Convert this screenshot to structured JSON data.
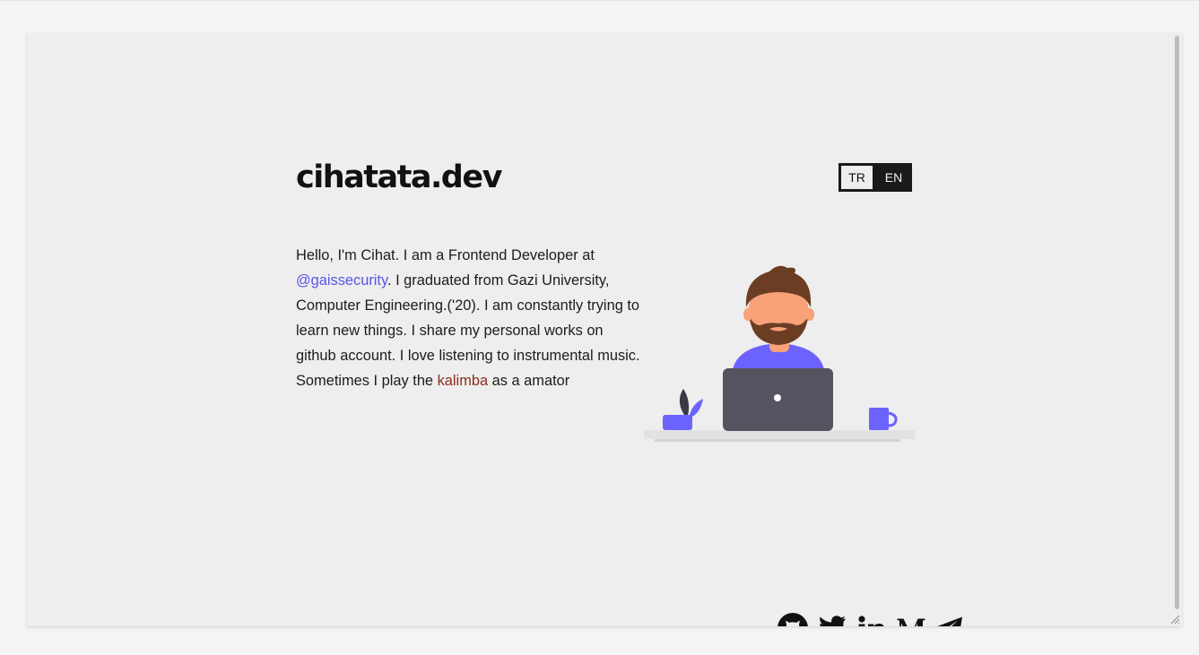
{
  "site": {
    "title": "cihatata.dev"
  },
  "language": {
    "options": [
      {
        "label": "TR",
        "active": true
      },
      {
        "label": "EN",
        "active": false
      }
    ]
  },
  "bio": {
    "part1": "Hello, I'm Cihat. I am a Frontend Developer at ",
    "company_link": "@gaissecurity",
    "part2": ". I graduated from Gazi University, Computer Engineering.('20). I am constantly trying to learn new things. I share my personal works on github account. I love listening to instrumental music. Sometimes I play the ",
    "kalimba_link": "kalimba",
    "part3": " as a amator"
  },
  "illustration": {
    "name": "developer-at-laptop"
  },
  "social": [
    {
      "name": "github-icon"
    },
    {
      "name": "twitter-icon"
    },
    {
      "name": "linkedin-icon"
    },
    {
      "name": "medium-icon"
    },
    {
      "name": "telegram-icon"
    }
  ],
  "colors": {
    "accent": "#6c63ff",
    "link": "#5b54e6",
    "kalimba_link": "#8b2d1c",
    "text": "#1c1c1c",
    "background": "#eeeeee"
  }
}
